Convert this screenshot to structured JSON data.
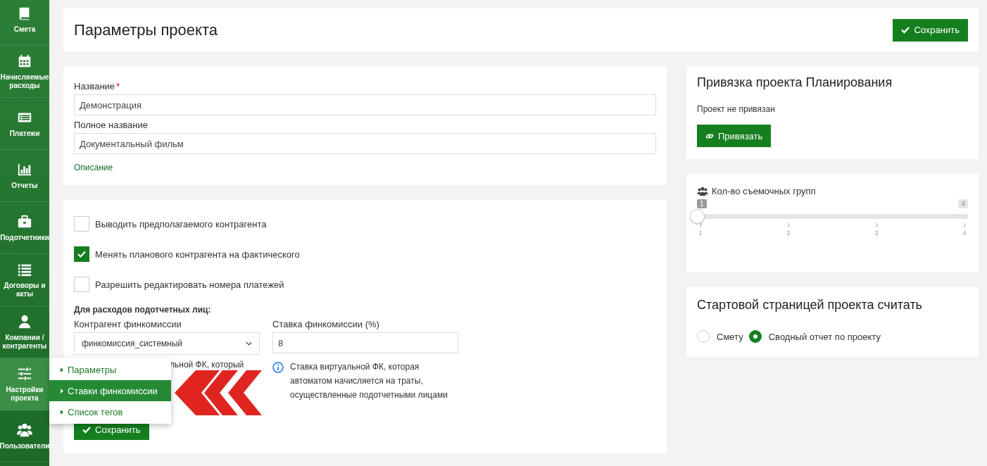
{
  "sidebar": {
    "items": [
      {
        "label": "Смета",
        "selected": false
      },
      {
        "label": "Начисляемые расходы",
        "selected": false
      },
      {
        "label": "Платежи",
        "selected": false
      },
      {
        "label": "Отчеты",
        "selected": false
      },
      {
        "label": "Подотчетники",
        "selected": false
      },
      {
        "label": "Договоры и акты",
        "selected": false
      },
      {
        "label": "Компании / контрагенты",
        "selected": false
      },
      {
        "label": "Настройки проекта",
        "selected": true
      },
      {
        "label": "Пользователи",
        "selected": false
      }
    ]
  },
  "header": {
    "title": "Параметры проекта",
    "save_button": "Сохранить"
  },
  "main_form": {
    "fields": [
      {
        "label": "Название",
        "required_mark": "*",
        "value": "Демонстрация"
      },
      {
        "label": "Полное название",
        "value": "Документальный фильм"
      }
    ],
    "description_link": "Описание"
  },
  "options": {
    "checkboxes": [
      {
        "label": "Выводить предполагаемого контрагента",
        "checked": false
      },
      {
        "label": "Менять планового контрагента на фактического",
        "checked": true
      },
      {
        "label": "Разрешить редактировать номера платежей",
        "checked": false
      }
    ],
    "section_title": "Для расходов подотчетных лиц:",
    "counterparty": {
      "label": "Контрагент финкомиссии",
      "value": "финкомиссия_системный"
    },
    "rate": {
      "label": "Ставка финкомиссии (%)",
      "value": "8"
    },
    "help_left": "льной ФК, который",
    "help_right": "Ставка виртуальной ФК, которая автоматом начисляется на траты, осуществленные подотчетными лицами",
    "save_button": "Сохранить"
  },
  "flyout_menu": [
    {
      "label": "Параметры",
      "selected": false
    },
    {
      "label": "Ставки финкомиссии",
      "selected": true
    },
    {
      "label": "Список тегов",
      "selected": false
    }
  ],
  "planning_link": {
    "title": "Привязка проекта Планирования",
    "status": "Проект не привязан",
    "button": "Привязать"
  },
  "crews": {
    "label": "Кол-во съемочных групп",
    "min": "1",
    "max": "4",
    "level": 0,
    "ticks": [
      "1",
      "2",
      "3",
      "4"
    ]
  },
  "start_page": {
    "title": "Стартовой страницей проекта считать",
    "options": [
      {
        "label": "Смету",
        "selected": false
      },
      {
        "label": "Сводный отчет по проекту",
        "selected": true
      }
    ]
  }
}
